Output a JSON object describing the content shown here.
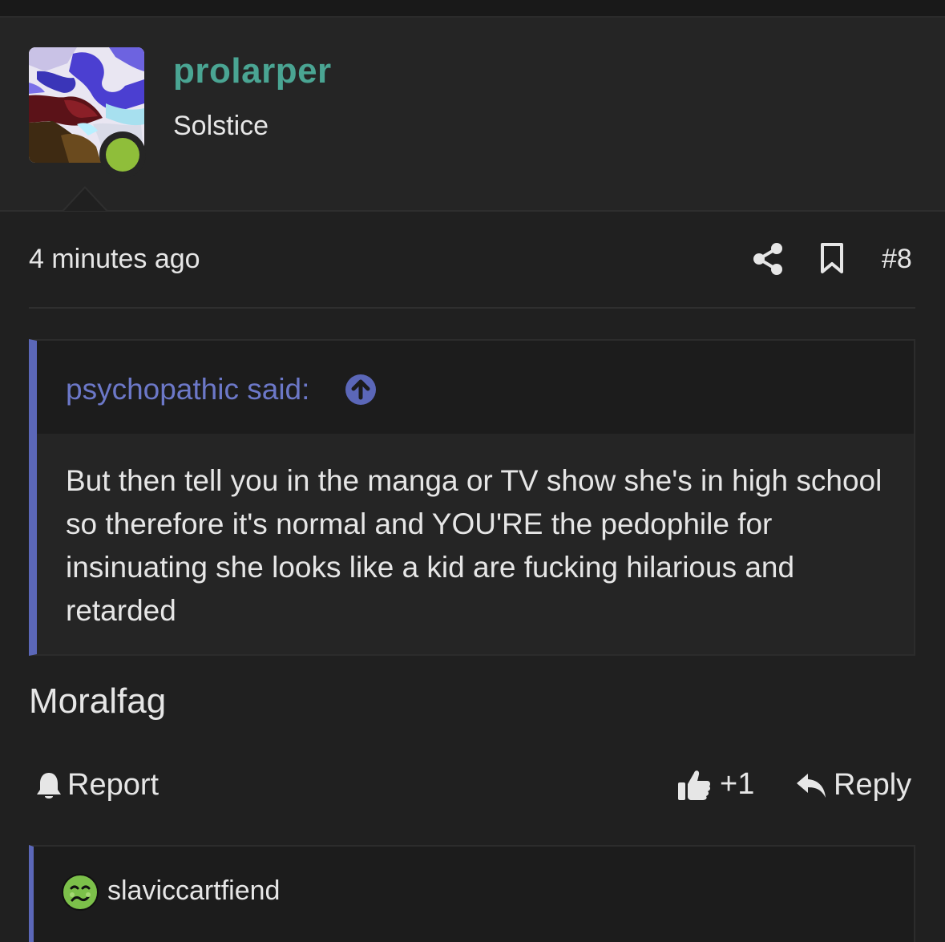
{
  "post": {
    "author": {
      "username": "prolarper",
      "title": "Solstice",
      "online": true,
      "username_color": "#4aa593",
      "online_color": "#8fbe3a"
    },
    "timestamp": "4 minutes ago",
    "post_number": "#8",
    "icons": {
      "share": "share-icon",
      "bookmark": "bookmark-icon"
    },
    "quote": {
      "author_label": "psychopathic said:",
      "text": "But then tell you in the manga or TV show she's in high school so therefore it's normal and YOU'RE the pedophile for insinuating she looks like a kid are fucking hilarious and retarded",
      "accent_color": "#5b67b8"
    },
    "body": "Moralfag",
    "actions": {
      "report_label": "Report",
      "like_count": "+1",
      "reply_label": "Reply"
    }
  },
  "reaction_list": {
    "first_user": "slaviccartfiend",
    "reaction_icon": "nauseated-face-icon"
  }
}
